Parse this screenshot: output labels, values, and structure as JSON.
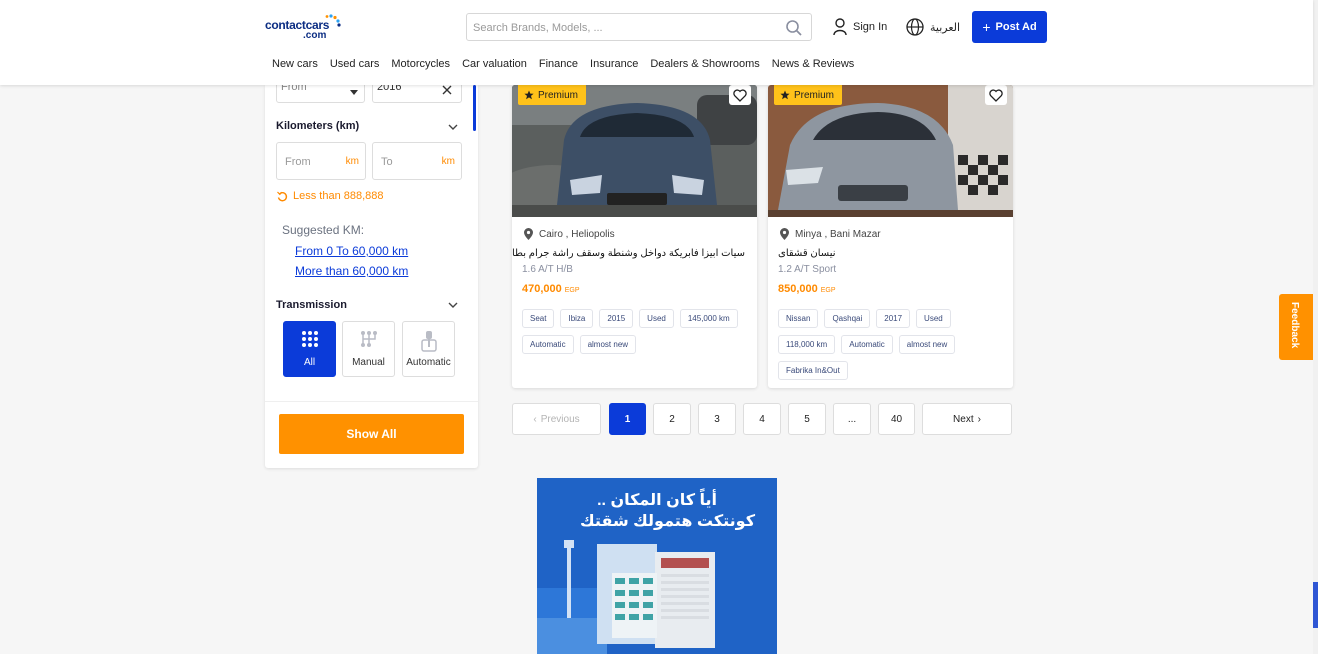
{
  "header": {
    "logo_main": "contactcars",
    "logo_sub": ".com",
    "search_placeholder": "Search Brands, Models, ...",
    "signin_label": "Sign In",
    "language_label": "العربية",
    "post_ad_label": "Post Ad",
    "nav": [
      "New cars",
      "Used cars",
      "Motorcycles",
      "Car valuation",
      "Finance",
      "Insurance",
      "Dealers & Showrooms",
      "News & Reviews"
    ]
  },
  "filters": {
    "year_from_placeholder": "From",
    "year_to_value": "2016",
    "km_title": "Kilometers (km)",
    "km_from_placeholder": "From",
    "km_to_placeholder": "To",
    "km_unit": "km",
    "less_than": "Less than 888,888",
    "suggested_title": "Suggested KM:",
    "suggested_links": [
      "From 0 To 60,000 km",
      "More than 60,000 km"
    ],
    "transmission_title": "Transmission",
    "transmission_options": [
      "All",
      "Manual",
      "Automatic"
    ],
    "show_all_label": "Show All"
  },
  "listings": [
    {
      "badge": "Premium",
      "location": "Cairo , Heliopolis",
      "title": "سيات ابيزا فابريكة دواخل وشنطة وسقف راشة جرام بطانة فقط",
      "trim": "1.6 A/T H/B",
      "price": "470,000",
      "currency": "EGP",
      "tags": [
        "Seat",
        "Ibiza",
        "2015",
        "Used",
        "145,000 km",
        "Automatic",
        "almost new"
      ]
    },
    {
      "badge": "Premium",
      "location": "Minya , Bani Mazar",
      "title": "نيسان قشقاى",
      "trim": "1.2 A/T Sport",
      "price": "850,000",
      "currency": "EGP",
      "tags": [
        "Nissan",
        "Qashqai",
        "2017",
        "Used",
        "118,000 km",
        "Automatic",
        "almost new",
        "Fabrika In&Out"
      ]
    }
  ],
  "pagination": {
    "previous_label": "Previous",
    "pages": [
      "1",
      "2",
      "3",
      "4",
      "5",
      "...",
      "40"
    ],
    "current": "1",
    "next_label": "Next"
  },
  "banner": {
    "line1": "أياً كان المكان ..",
    "line2": "كونتكت هتمولك شقتك"
  },
  "feedback_label": "Feedback",
  "colors": {
    "brand_blue": "#0b3bd9",
    "accent_orange": "#ff9100",
    "premium_yellow": "#ffc21a"
  }
}
